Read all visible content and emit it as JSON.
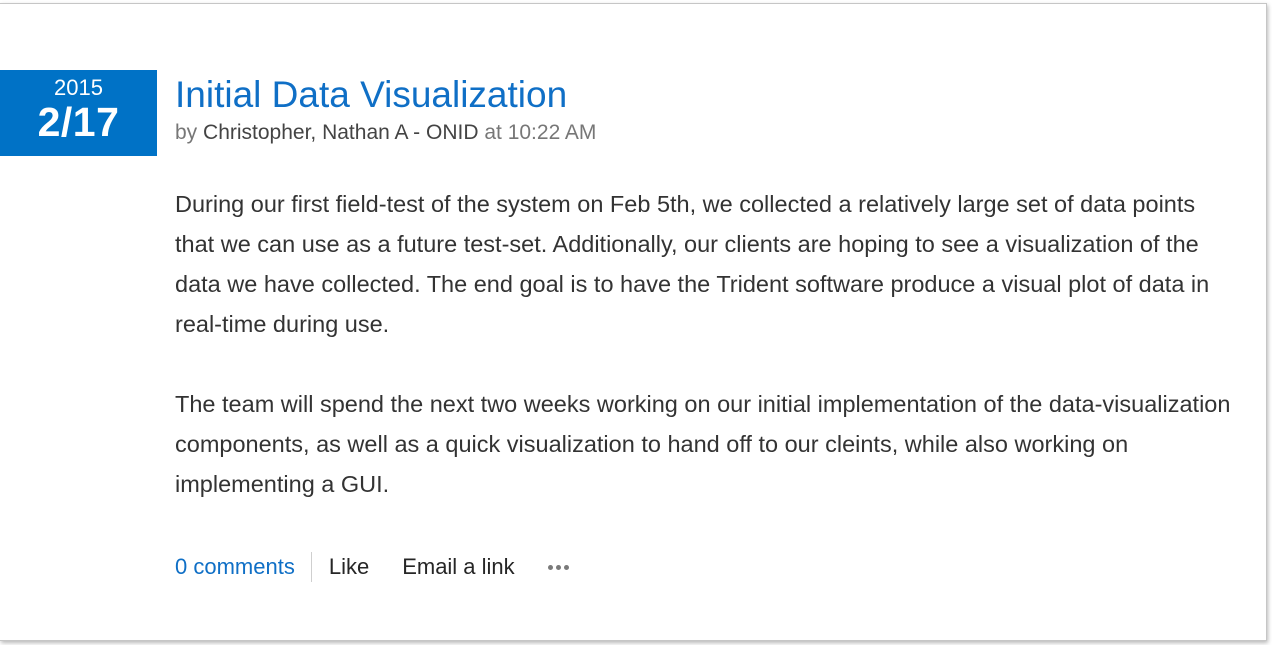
{
  "post": {
    "date": {
      "year": "2015",
      "day": "2/17"
    },
    "title": "Initial Data Visualization",
    "byline": {
      "by_label": "by",
      "author": "Christopher, Nathan A - ONID",
      "at_label": "at",
      "time": "10:22 AM"
    },
    "paragraphs": [
      "During our first field-test of the system on Feb 5th, we collected a relatively large set of data points that we can use as a future test-set. Additionally, our clients are hoping to see a visualization of the data we have collected. The end goal is to have the Trident software produce a visual plot of data in real-time during use.",
      "The team will spend the next two weeks working on our initial implementation of the data-visualization components, as well as a quick visualization to hand off to our cleints, while also working on implementing a GUI."
    ]
  },
  "actions": {
    "comments": "0 comments",
    "like": "Like",
    "email": "Email a link",
    "more_icon": "ellipsis-icon"
  },
  "colors": {
    "accent": "#0072c6",
    "link": "#0f6fc6",
    "body_text": "#333333"
  }
}
